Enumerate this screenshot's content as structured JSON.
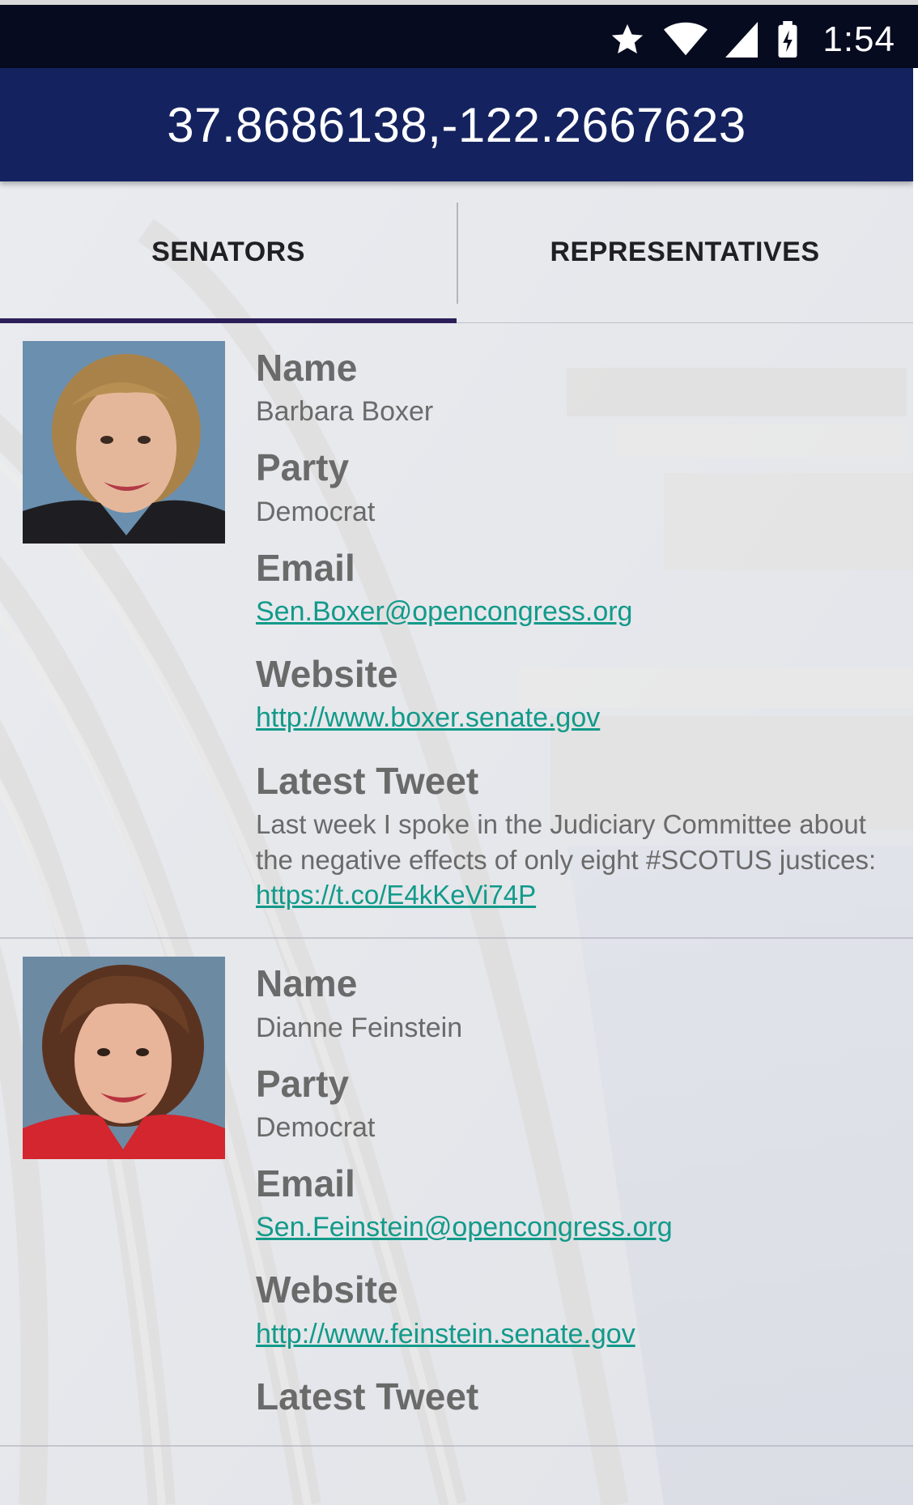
{
  "status_bar": {
    "time": "1:54",
    "icons": [
      "star-icon",
      "wifi-icon",
      "cell-signal-icon",
      "battery-charging-icon"
    ]
  },
  "app_bar": {
    "title": "37.8686138,-122.2667623",
    "color": "#14235f"
  },
  "tabs": [
    {
      "label": "SENATORS",
      "selected": true
    },
    {
      "label": "REPRESENTATIVES",
      "selected": false
    }
  ],
  "labels": {
    "name": "Name",
    "party": "Party",
    "email": "Email",
    "website": "Website",
    "tweet": "Latest Tweet"
  },
  "senators": [
    {
      "name": "Barbara Boxer",
      "party": "Democrat",
      "email": "Sen.Boxer@opencongress.org",
      "website": "http://www.boxer.senate.gov",
      "tweet_text": "Last week I spoke in the Judiciary Committee about the negative effects of only eight #SCOTUS justices: ",
      "tweet_link": "https://t.co/E4kKeVi74P"
    },
    {
      "name": "Dianne Feinstein",
      "party": "Democrat",
      "email": "Sen.Feinstein@opencongress.org",
      "website": "http://www.feinstein.senate.gov"
    }
  ],
  "colors": {
    "link": "#129a8a",
    "label": "#6a6a6a",
    "tab_indicator": "#2c1f58",
    "status_bar": "#070b1f"
  }
}
